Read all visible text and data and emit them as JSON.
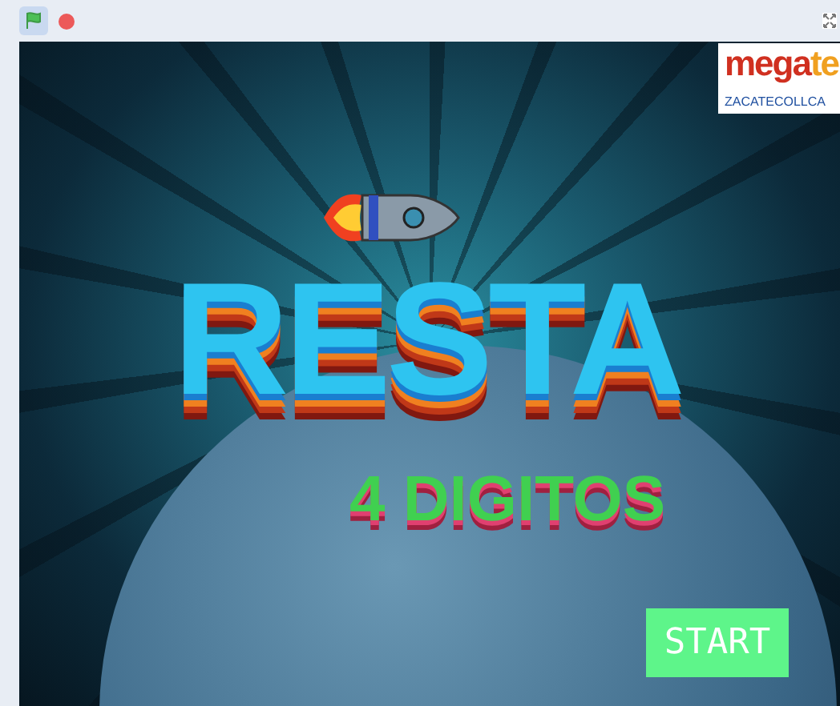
{
  "toolbar": {
    "green_flag_selected": true
  },
  "stage": {
    "logo": {
      "brand": "mega",
      "brand_tail": "te",
      "caption": "ZACATECOLLCA"
    },
    "title": "RESTA",
    "subtitle": "4 DIGITOS",
    "start_button": "START"
  }
}
